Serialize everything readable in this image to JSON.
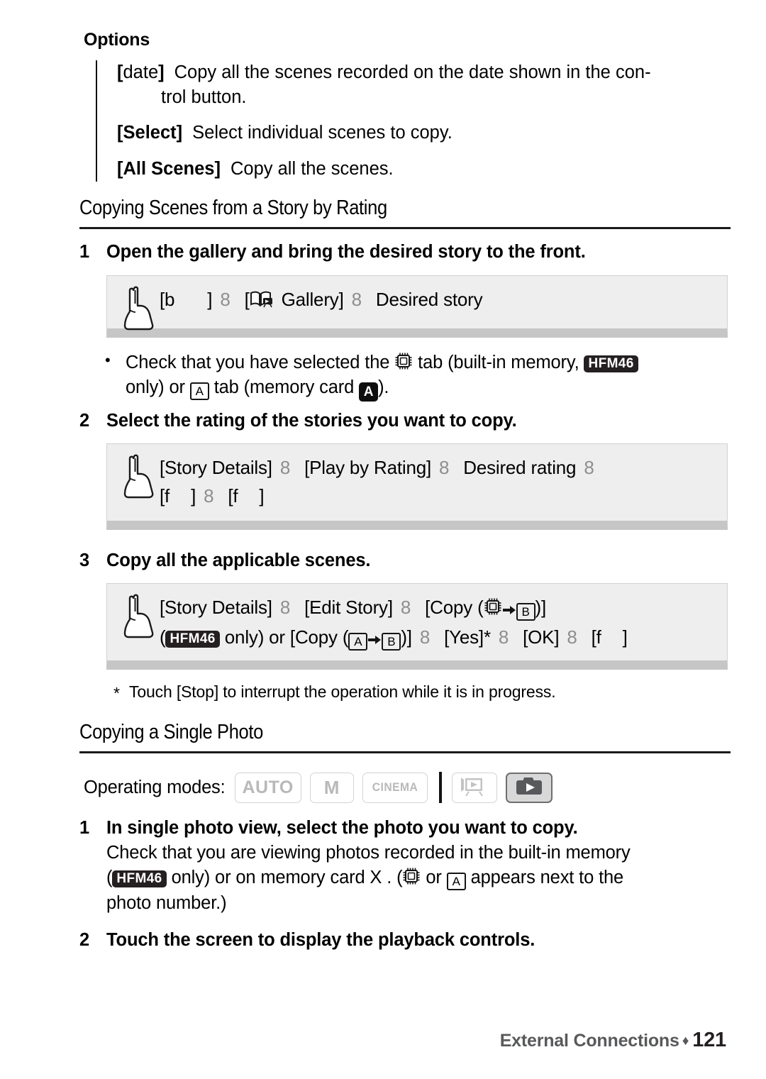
{
  "options": {
    "title": "Options",
    "items": [
      {
        "key_open": "[",
        "key_label": "date",
        "key_close": "]",
        "key_style": "bracket-bold-label-regular",
        "description": "Copy all the scenes recorded on the date shown in the con-",
        "description_cont": "trol button."
      },
      {
        "key_open": "[",
        "key_label": "Select",
        "key_close": "]",
        "key_style": "all-bold",
        "description": "Select individual scenes to copy.",
        "description_cont": ""
      },
      {
        "key_open": "[",
        "key_label": "All Scenes",
        "key_close": "]",
        "key_style": "all-bold",
        "description": "Copy all the scenes.",
        "description_cont": ""
      }
    ]
  },
  "section_rating": {
    "heading": "Copying Scenes from a Story by Rating",
    "step1": {
      "number": "1",
      "text": "Open the gallery and bring the desired story to the front."
    },
    "touchbox1": {
      "part_a": "[b",
      "part_b": "]",
      "arrow1": "8",
      "part_c": "[",
      "gallery_label": "Gallery]",
      "arrow2": "8",
      "part_d": "Desired story",
      "gallery_icon": "gallery-book-icon",
      "hand_icon": "pointing-hand-icon"
    },
    "bullet": {
      "marker": "•",
      "text_1": "Check that you have selected the",
      "chip_icon": "built-in-memory-chip-icon",
      "text_2": "tab (built-in memory,",
      "model_badge": "HFM46",
      "text_3": "only) or",
      "tab_a_icon": "A",
      "text_4": "tab (memory card",
      "card_a_badge": "A",
      "text_5": ")."
    },
    "step2": {
      "number": "2",
      "text": "Select the rating of the stories you want to copy."
    },
    "touchbox2": {
      "line1_a": "[Story Details]",
      "line1_arrow1": "8",
      "line1_b": "[Play by Rating]",
      "line1_arrow2": "8",
      "line1_c": "Desired rating",
      "line1_arrow3": "8",
      "line2_a": "[f",
      "line2_b": "]",
      "line2_arrow1": "8",
      "line2_c": "[f",
      "line2_d": "]",
      "hand_icon": "pointing-hand-icon"
    },
    "step3": {
      "number": "3",
      "text": "Copy all the applicable scenes."
    },
    "touchbox3": {
      "line1_a": "[Story Details]",
      "line1_arrow1": "8",
      "line1_b": "[Edit Story]",
      "line1_arrow2": "8",
      "line1_c": "[Copy (",
      "line1_chip_icon": "built-in-memory-chip-icon",
      "line1_arrow_solid": "⮞",
      "line1_b_box": "B",
      "line1_d": ")]",
      "line2_open": "(",
      "line2_badge": "HFM46",
      "line2_a": "only) or [Copy (",
      "line2_a_box": "A",
      "line2_arrow_solid": "⮞",
      "line2_b_box": "B",
      "line2_b": ")]",
      "line2_arrow1": "8",
      "line2_c": "[Yes]*",
      "line2_arrow2": "8",
      "line2_d": "[OK]",
      "line2_arrow3": "8",
      "line2_e": "[f",
      "line2_f": "]",
      "hand_icon": "pointing-hand-icon"
    },
    "footnote": {
      "marker": "*",
      "text": "Touch [Stop] to interrupt the operation while it is in progress."
    }
  },
  "section_single_photo": {
    "heading": "Copying a Single Photo",
    "operating_modes": {
      "label": "Operating modes:",
      "chips": [
        {
          "id": "auto",
          "label": "AUTO",
          "state": "inactive",
          "type": "text"
        },
        {
          "id": "manual",
          "label": "M",
          "state": "inactive",
          "type": "text"
        },
        {
          "id": "cinema",
          "label": "CINEMA",
          "state": "inactive",
          "type": "text"
        },
        {
          "id": "movie-playback",
          "label": "",
          "state": "inactive",
          "type": "icon",
          "icon": "movie-playback-icon"
        },
        {
          "id": "photo-playback",
          "label": "",
          "state": "active",
          "type": "icon",
          "icon": "photo-playback-icon"
        }
      ]
    },
    "step1": {
      "number": "1",
      "text": "In single photo view, select the photo you want to copy.",
      "sub_1": "Check that you are viewing photos recorded in the built-in memory",
      "sub_2_open": "(",
      "sub_2_badge": "HFM46",
      "sub_2_a": "only) or on memory card X",
      "sub_2_b": ". (",
      "sub_2_chip": "built-in-memory-chip-icon",
      "sub_2_c": "or",
      "sub_2_a_box": "A",
      "sub_2_d": "appears next to the",
      "sub_3": "photo number.)"
    },
    "step2": {
      "number": "2",
      "text": "Touch the screen to display the playback controls."
    }
  },
  "footer": {
    "chapter": "External Connections",
    "separator": "♦",
    "page_number": "121"
  },
  "colors": {
    "badge_dark": "#241f20",
    "touchbox_fill": "#eeeeee",
    "touchbox_shadow": "#c6c6c6",
    "arrow_gray": "#8e8e8e",
    "mode_inactive": "#b9b9b9",
    "footer_gray": "#58595b"
  }
}
